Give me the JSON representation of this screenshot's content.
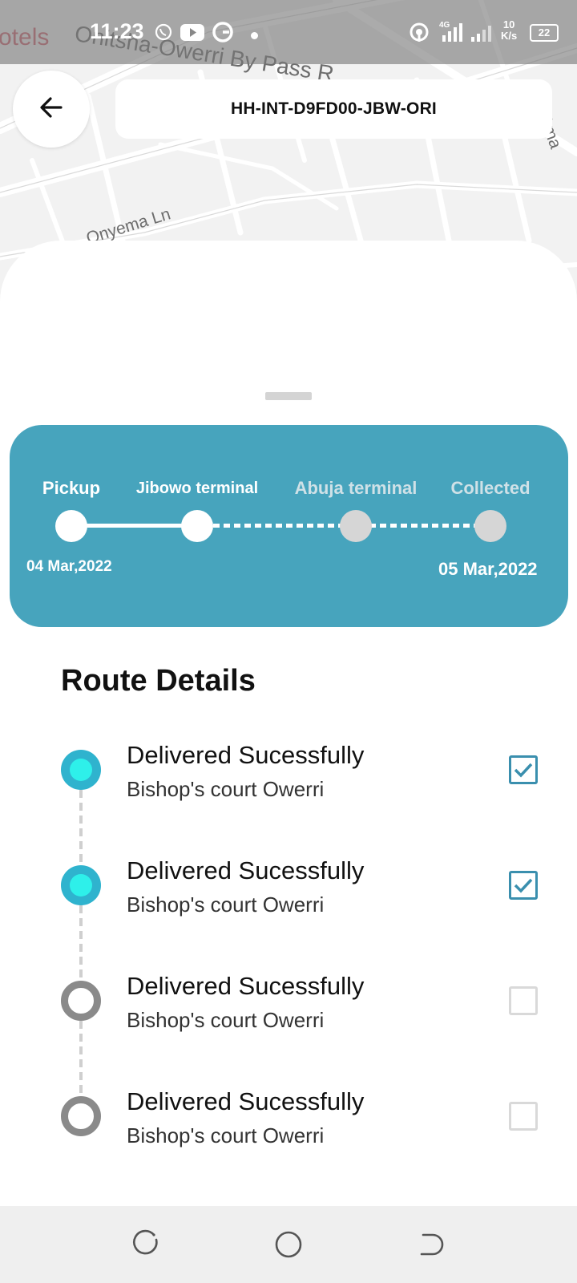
{
  "status_bar": {
    "time": "11:23",
    "net_speed_value": "10",
    "net_speed_unit": "K/s",
    "network": "4G",
    "battery": "22",
    "icons": [
      "whatsapp-icon",
      "youtube-icon",
      "grammarly-icon",
      "notification-dot-icon",
      "hotspot-icon",
      "signal-icon",
      "signal-icon-2"
    ]
  },
  "map": {
    "labels": [
      "otels",
      "Onitsha-Owerri By Pass R",
      "Onyema Ln",
      "Ama"
    ],
    "colors": {
      "background": "#f2f2f2",
      "road": "#ffffff",
      "hotel_label": "#d0636e"
    }
  },
  "header": {
    "back_icon": "arrow-left-icon",
    "tracking_id": "HH-INT-D9FD00-JBW-ORI"
  },
  "progress": {
    "accent": "#47a4bd",
    "stages": [
      {
        "label": "Pickup",
        "status": "done"
      },
      {
        "label": "Jibowo terminal",
        "status": "done"
      },
      {
        "label": "Abuja terminal",
        "status": "pending"
      },
      {
        "label": "Collected",
        "status": "pending"
      }
    ],
    "start_date": "04 Mar,2022",
    "end_date": "05 Mar,2022"
  },
  "route": {
    "title": "Route Details",
    "items": [
      {
        "title": "Delivered Sucessfully",
        "location": "Bishop's court Owerri",
        "completed": true
      },
      {
        "title": "Delivered Sucessfully",
        "location": "Bishop's court Owerri",
        "completed": true
      },
      {
        "title": "Delivered Sucessfully",
        "location": "Bishop's court Owerri",
        "completed": false
      },
      {
        "title": "Delivered Sucessfully",
        "location": "Bishop's court Owerri",
        "completed": false
      }
    ]
  },
  "nav": {
    "icons": [
      "recent-apps-icon",
      "home-icon",
      "back-icon"
    ]
  }
}
